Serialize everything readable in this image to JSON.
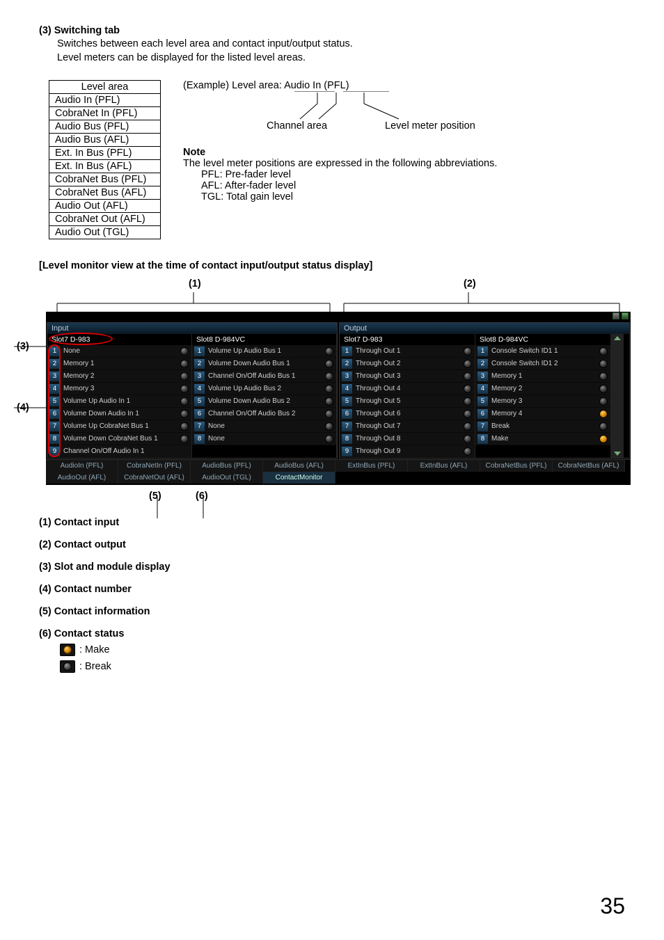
{
  "section3": {
    "heading": "(3) Switching tab",
    "line1": "Switches between each level area and contact input/output status.",
    "line2": "Level meters can be displayed for the listed level areas."
  },
  "level_area_table": {
    "header": "Level area",
    "rows": [
      "Audio In (PFL)",
      "CobraNet In (PFL)",
      "Audio Bus (PFL)",
      "Audio Bus (AFL)",
      "Ext. In Bus (PFL)",
      "Ext. In Bus (AFL)",
      "CobraNet Bus (PFL)",
      "CobraNet Bus (AFL)",
      "Audio Out (AFL)",
      "CobraNet Out (AFL)",
      "Audio Out (TGL)"
    ]
  },
  "example": {
    "text": "(Example) Level area: Audio In (PFL)",
    "ch_area": "Channel area",
    "meter_pos": "Level meter position"
  },
  "note": {
    "head": "Note",
    "body": "The level meter positions are expressed in the following abbreviations.",
    "pfl": "PFL: Pre-fader level",
    "afl": "AFL: After-fader level",
    "tgl": "TGL: Total gain level"
  },
  "monitor_heading": "[Level monitor view at the time of contact input/output status display]",
  "top_annots": {
    "a1": "(1)",
    "a2": "(2)"
  },
  "side_annots": {
    "a3": "(3)",
    "a4": "(4)"
  },
  "bottom_annots": {
    "a5": "(5)",
    "a6": "(6)"
  },
  "panels": {
    "input_label": "Input",
    "output_label": "Output",
    "in_slotA": {
      "head": "Slot7 D-983",
      "items": [
        {
          "n": "1",
          "t": "None",
          "led": "break"
        },
        {
          "n": "2",
          "t": "Memory 1",
          "led": "break"
        },
        {
          "n": "3",
          "t": "Memory 2",
          "led": "break"
        },
        {
          "n": "4",
          "t": "Memory 3",
          "led": "break"
        },
        {
          "n": "5",
          "t": "Volume Up Audio In 1",
          "led": "break"
        },
        {
          "n": "6",
          "t": "Volume Down Audio In 1",
          "led": "break"
        },
        {
          "n": "7",
          "t": "Volume Up CobraNet Bus 1",
          "led": "break"
        },
        {
          "n": "8",
          "t": "Volume Down CobraNet Bus 1",
          "led": "break"
        },
        {
          "n": "9",
          "t": "Channel On/Off Audio In 1",
          "led": ""
        }
      ]
    },
    "in_slotB": {
      "head": "Slot8 D-984VC",
      "items": [
        {
          "n": "1",
          "t": "Volume Up Audio Bus 1",
          "led": "break"
        },
        {
          "n": "2",
          "t": "Volume Down Audio Bus 1",
          "led": "break"
        },
        {
          "n": "3",
          "t": "Channel On/Off Audio Bus 1",
          "led": "break"
        },
        {
          "n": "4",
          "t": "Volume Up Audio Bus 2",
          "led": "break"
        },
        {
          "n": "5",
          "t": "Volume Down Audio Bus 2",
          "led": "break"
        },
        {
          "n": "6",
          "t": "Channel On/Off Audio Bus 2",
          "led": "break"
        },
        {
          "n": "7",
          "t": "None",
          "led": "break"
        },
        {
          "n": "8",
          "t": "None",
          "led": "break"
        }
      ]
    },
    "out_slotA": {
      "head": "Slot7 D-983",
      "items": [
        {
          "n": "1",
          "t": "Through Out 1",
          "led": "break"
        },
        {
          "n": "2",
          "t": "Through Out 2",
          "led": "break"
        },
        {
          "n": "3",
          "t": "Through Out 3",
          "led": "break"
        },
        {
          "n": "4",
          "t": "Through Out 4",
          "led": "break"
        },
        {
          "n": "5",
          "t": "Through Out 5",
          "led": "break"
        },
        {
          "n": "6",
          "t": "Through Out 6",
          "led": "break"
        },
        {
          "n": "7",
          "t": "Through Out 7",
          "led": "break"
        },
        {
          "n": "8",
          "t": "Through Out 8",
          "led": "break"
        },
        {
          "n": "9",
          "t": "Through Out 9",
          "led": "break"
        }
      ]
    },
    "out_slotB": {
      "head": "Slot8 D-984VC",
      "items": [
        {
          "n": "1",
          "t": "Console Switch ID1 1",
          "led": "break"
        },
        {
          "n": "2",
          "t": "Console Switch ID1 2",
          "led": "break"
        },
        {
          "n": "3",
          "t": "Memory 1",
          "led": "break"
        },
        {
          "n": "4",
          "t": "Memory 2",
          "led": "break"
        },
        {
          "n": "5",
          "t": "Memory 3",
          "led": "break"
        },
        {
          "n": "6",
          "t": "Memory 4",
          "led": "make"
        },
        {
          "n": "7",
          "t": "Break",
          "led": "break"
        },
        {
          "n": "8",
          "t": "Make",
          "led": "make"
        }
      ]
    }
  },
  "tabs": [
    "AudioIn (PFL)",
    "CobraNetIn (PFL)",
    "AudioBus (PFL)",
    "AudioBus (AFL)",
    "ExtInBus (PFL)",
    "ExtInBus (AFL)",
    "CobraNetBus (PFL)",
    "CobraNetBus (AFL)",
    "AudioOut (AFL)",
    "CobraNetOut (AFL)",
    "AudioOut (TGL)",
    "ContactMonitor"
  ],
  "legend": {
    "l1": "(1) Contact input",
    "l2": "(2) Contact output",
    "l3": "(3) Slot and module display",
    "l4": "(4) Contact number",
    "l5": "(5) Contact information",
    "l6": "(6) Contact status",
    "make": ": Make",
    "break": ": Break"
  },
  "page": "35"
}
